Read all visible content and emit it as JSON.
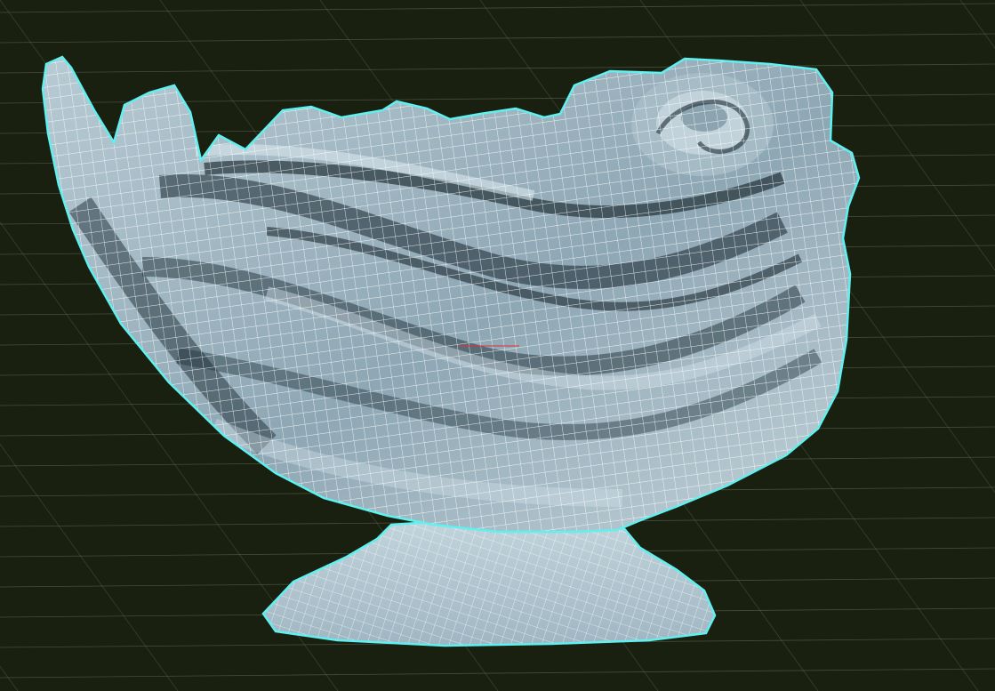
{
  "viewport": {
    "name": "3d-perspective-viewport",
    "background_color": "#19200f",
    "grid_color": "#6b6f66",
    "mesh_edge_color": "#ffffff",
    "selection_outline_color": "#5ff0f0",
    "surface_light_color": "#b8cbd4",
    "surface_shadow_color": "#16252e",
    "axis_color": "#e03030",
    "show_grid": true,
    "show_wireframe": true,
    "object": {
      "kind": "shell-shaped bowl on a pedestal",
      "selected": true
    }
  }
}
